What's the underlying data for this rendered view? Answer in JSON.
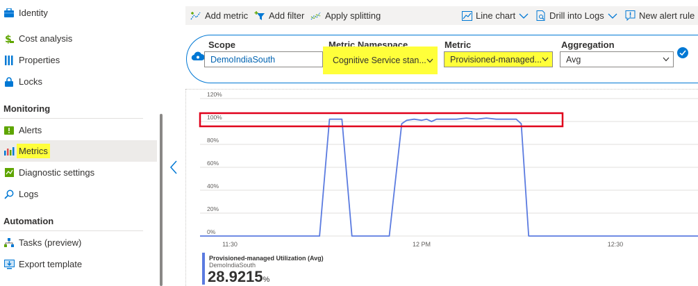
{
  "sidebar": {
    "items": [
      {
        "label": "Identity",
        "icon": "briefcase-icon"
      },
      {
        "label": "Cost analysis",
        "icon": "dollar-icon"
      },
      {
        "label": "Properties",
        "icon": "properties-icon"
      },
      {
        "label": "Locks",
        "icon": "lock-icon"
      }
    ],
    "monitoring_header": "Monitoring",
    "monitoring_items": [
      {
        "label": "Alerts",
        "icon": "alert-icon"
      },
      {
        "label": "Metrics",
        "icon": "metrics-icon",
        "selected": true
      },
      {
        "label": "Diagnostic settings",
        "icon": "diagnostic-icon"
      },
      {
        "label": "Logs",
        "icon": "logs-search-icon"
      }
    ],
    "automation_header": "Automation",
    "automation_items": [
      {
        "label": "Tasks (preview)",
        "icon": "tasks-icon"
      },
      {
        "label": "Export template",
        "icon": "export-icon"
      }
    ]
  },
  "toolbar": {
    "add_metric": "Add metric",
    "add_filter": "Add filter",
    "apply_splitting": "Apply splitting",
    "line_chart": "Line chart",
    "drill_logs": "Drill into Logs",
    "new_alert": "New alert rule"
  },
  "metric_selector": {
    "scope_label": "Scope",
    "scope_value": "DemoIndiaSouth",
    "namespace_label": "Metric Namespace",
    "namespace_value": "Cognitive Service stan...",
    "metric_label": "Metric",
    "metric_value": "Provisioned-managed...",
    "aggregation_label": "Aggregation",
    "aggregation_value": "Avg"
  },
  "chart_data": {
    "type": "line",
    "y_ticks": [
      "120%",
      "100%",
      "80%",
      "60%",
      "40%",
      "20%",
      "0%"
    ],
    "x_ticks": [
      "11:30",
      "12 PM",
      "12:30"
    ],
    "ylim": [
      0,
      120
    ],
    "grid": true,
    "series": [
      {
        "name": "Provisioned-managed Utilization (Avg)",
        "color": "#5b7be0",
        "points": [
          [
            0,
            0
          ],
          [
            24,
            0
          ],
          [
            26,
            102
          ],
          [
            28.5,
            102
          ],
          [
            30.5,
            0
          ],
          [
            38,
            0
          ],
          [
            40.5,
            98
          ],
          [
            41.5,
            101
          ],
          [
            43,
            102
          ],
          [
            44.5,
            101
          ],
          [
            45.5,
            102
          ],
          [
            46.5,
            100
          ],
          [
            47.5,
            102
          ],
          [
            49.5,
            102
          ],
          [
            51.5,
            102
          ],
          [
            53.5,
            103
          ],
          [
            55.5,
            102
          ],
          [
            57.5,
            103
          ],
          [
            59.5,
            102
          ],
          [
            61.5,
            102
          ],
          [
            63.5,
            102
          ],
          [
            64.5,
            98
          ],
          [
            66,
            0
          ],
          [
            100,
            0
          ]
        ]
      }
    ]
  },
  "legend": {
    "series_name": "Provisioned-managed Utilization (Avg)",
    "scope": "DemoIndiaSouth",
    "value": "28.9215",
    "unit": "%"
  },
  "colors": {
    "accent": "#0078d4",
    "series": "#5b7be0",
    "highlight_yellow": "#ffff3a",
    "annotation_red": "#e0001b"
  }
}
